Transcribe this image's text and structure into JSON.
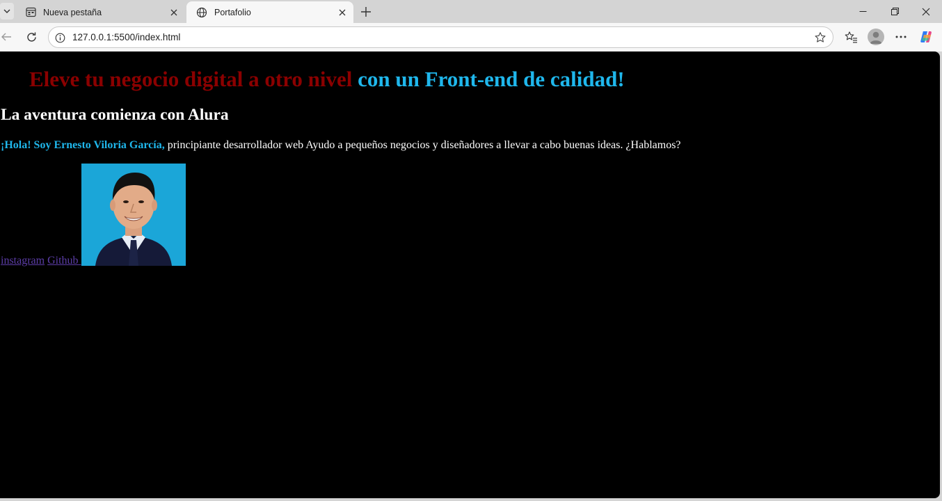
{
  "browser": {
    "tabs": [
      {
        "title": "Nueva pestaña",
        "icon": "new-tab-page-icon",
        "active": false
      },
      {
        "title": "Portafolio",
        "icon": "globe-icon",
        "active": true
      }
    ],
    "url": "127.0.0.1:5500/index.html"
  },
  "page": {
    "hero": {
      "part1": "Eleve tu negocio digital a otro nivel",
      "part2": "con un Front-end de calidad!"
    },
    "subtitle": "La aventura comienza con Alura",
    "intro": {
      "highlight": "¡Hola! Soy Ernesto Viloria García,",
      "rest": "principiante desarrollador web Ayudo a pequeños negocios y diseñadores a llevar a cabo buenas ideas. ¿Hablamos?"
    },
    "links": {
      "instagram": "instagram",
      "github": "Github"
    },
    "colors": {
      "background": "#000000",
      "hero_red": "#8b0000",
      "accent_blue": "#1fb7ec",
      "link": "#5c3da8"
    }
  }
}
